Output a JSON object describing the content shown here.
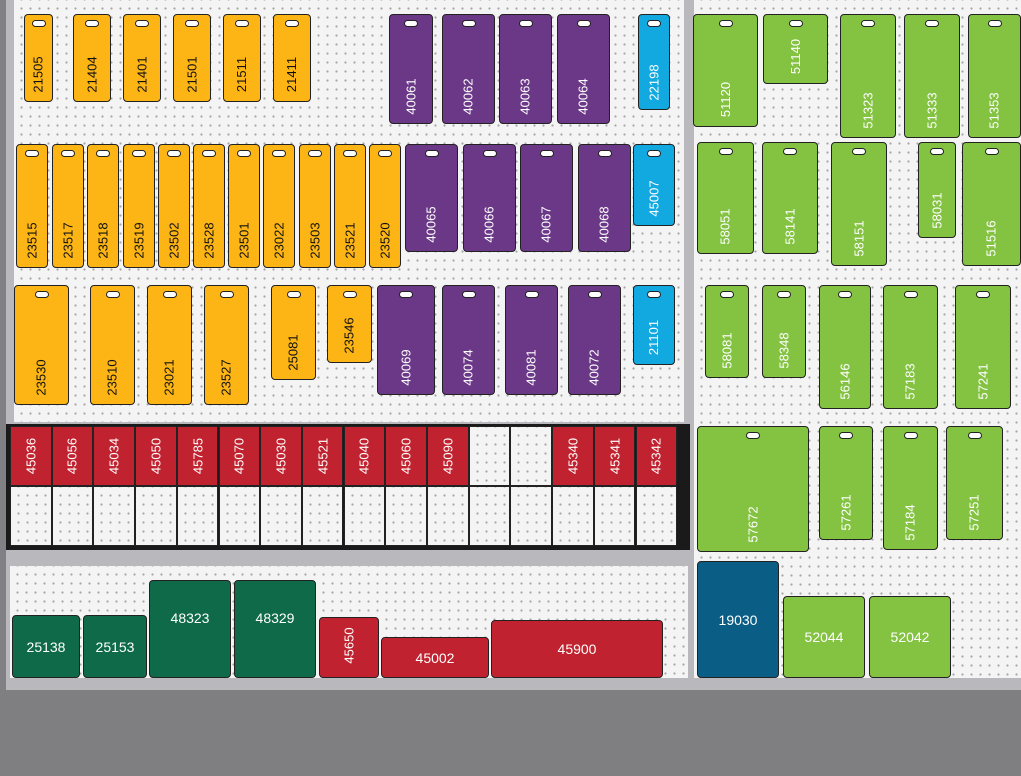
{
  "colors": {
    "orange": "#fdb515",
    "purple": "#6b3787",
    "blue": "#12a8e0",
    "green": "#84c341",
    "red": "#c0232f",
    "dark_green": "#0e6a48",
    "navy": "#0a5e86",
    "pegboard": "#f4f4f4",
    "floor": "#7f7f82"
  },
  "left_bay": {
    "row1": [
      "21505",
      "21404",
      "21401",
      "21501",
      "21511",
      "21411",
      "40061",
      "40062",
      "40063",
      "40064",
      "22198"
    ],
    "row2": [
      "23515",
      "23517",
      "23518",
      "23519",
      "23502",
      "23528",
      "23501",
      "23022",
      "23503",
      "23521",
      "23520",
      "40065",
      "40066",
      "40067",
      "40068",
      "45007"
    ],
    "row3": [
      "23530",
      "23510",
      "23021",
      "23527",
      "25081",
      "23546",
      "40069",
      "40074",
      "40081",
      "40072",
      "21101"
    ],
    "shelf_top": [
      "45036",
      "45056",
      "45034",
      "45050",
      "45785",
      "45070",
      "45030",
      "45521",
      "45040",
      "45060",
      "45090",
      "",
      "",
      "45340",
      "45341",
      "45342"
    ],
    "bottom": [
      "25138",
      "25153",
      "48323",
      "48329",
      "45650",
      "45002",
      "45900"
    ]
  },
  "right_bay": {
    "row1": [
      "51120",
      "51140",
      "51323",
      "51333",
      "51353"
    ],
    "row2": [
      "58051",
      "58141",
      "58151",
      "58031",
      "51516"
    ],
    "row3": [
      "58081",
      "58348",
      "56146",
      "57183",
      "57241"
    ],
    "row4": [
      "57672",
      "57261",
      "57184",
      "57251"
    ],
    "bottom": [
      "19030",
      "52044",
      "52042"
    ]
  }
}
